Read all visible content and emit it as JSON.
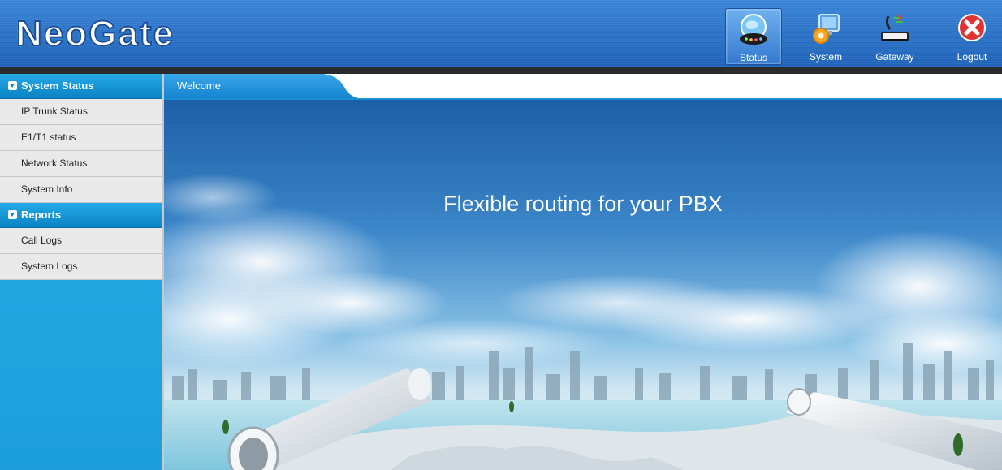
{
  "logo": {
    "text": "NeoGate"
  },
  "topnav": [
    {
      "label": "Status",
      "icon": "status-globe-icon",
      "active": true
    },
    {
      "label": "System",
      "icon": "system-monitor-gear-icon",
      "active": false
    },
    {
      "label": "Gateway",
      "icon": "gateway-device-icon",
      "active": false
    },
    {
      "label": "Logout",
      "icon": "logout-x-icon",
      "active": false
    }
  ],
  "sidebar": {
    "sections": [
      {
        "title": "System Status",
        "items": [
          "IP Trunk Status",
          "E1/T1 status",
          "Network Status",
          "System Info"
        ]
      },
      {
        "title": "Reports",
        "items": [
          "Call Logs",
          "System Logs"
        ]
      }
    ]
  },
  "tab": {
    "label": "Welcome"
  },
  "banner": {
    "headline": "Flexible routing for your PBX"
  },
  "colors": {
    "header": "#2a72c8",
    "sidebar": "#1fa6e0",
    "accent": "#1a8fd6"
  }
}
